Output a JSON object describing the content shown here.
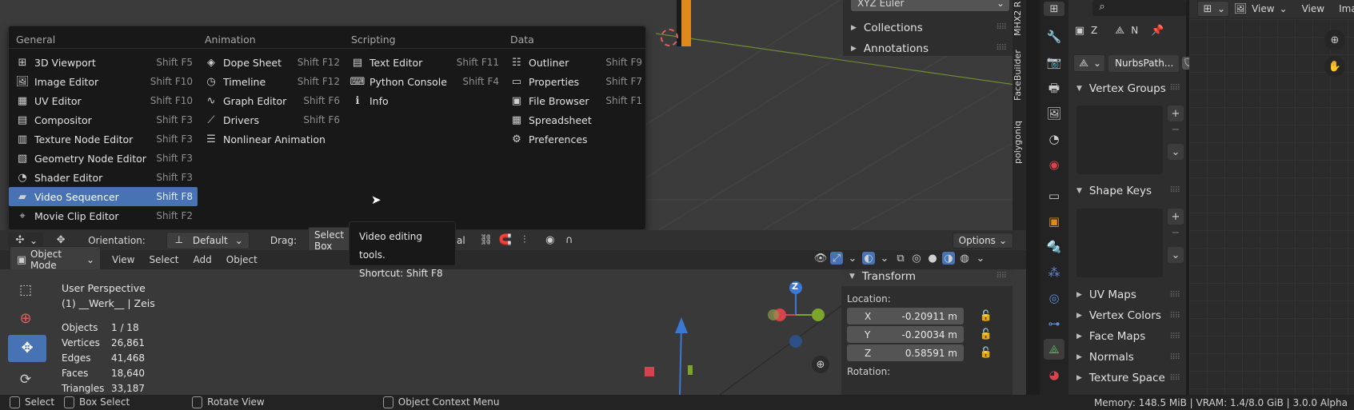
{
  "top_header": {
    "rotation_mode": "XYZ Euler",
    "collapsed_panels": [
      "Collections",
      "Annotations"
    ]
  },
  "side_tabs": [
    "MHX2 R",
    "FaceBuilder",
    "polygoniq"
  ],
  "editor_menu": {
    "columns": [
      {
        "title": "General",
        "items": [
          {
            "label": "3D Viewport",
            "shortcut": "Shift F5",
            "icon": "viewport-3d-icon"
          },
          {
            "label": "Image Editor",
            "shortcut": "Shift F10",
            "icon": "image-editor-icon"
          },
          {
            "label": "UV Editor",
            "shortcut": "Shift F10",
            "icon": "uv-editor-icon"
          },
          {
            "label": "Compositor",
            "shortcut": "Shift F3",
            "icon": "compositor-icon"
          },
          {
            "label": "Texture Node Editor",
            "shortcut": "Shift F3",
            "icon": "texture-node-icon"
          },
          {
            "label": "Geometry Node Editor",
            "shortcut": "Shift F3",
            "icon": "geometry-node-icon"
          },
          {
            "label": "Shader Editor",
            "shortcut": "Shift F3",
            "icon": "shader-editor-icon"
          },
          {
            "label": "Video Sequencer",
            "shortcut": "Shift F8",
            "icon": "video-sequencer-icon",
            "selected": true
          },
          {
            "label": "Movie Clip Editor",
            "shortcut": "Shift F2",
            "icon": "movie-clip-icon"
          }
        ]
      },
      {
        "title": "Animation",
        "items": [
          {
            "label": "Dope Sheet",
            "shortcut": "Shift F12",
            "icon": "dope-sheet-icon"
          },
          {
            "label": "Timeline",
            "shortcut": "Shift F12",
            "icon": "timeline-icon"
          },
          {
            "label": "Graph Editor",
            "shortcut": "Shift F6",
            "icon": "graph-editor-icon"
          },
          {
            "label": "Drivers",
            "shortcut": "Shift F6",
            "icon": "drivers-icon"
          },
          {
            "label": "Nonlinear Animation",
            "shortcut": "",
            "icon": "nla-icon"
          }
        ]
      },
      {
        "title": "Scripting",
        "items": [
          {
            "label": "Text Editor",
            "shortcut": "Shift F11",
            "icon": "text-editor-icon"
          },
          {
            "label": "Python Console",
            "shortcut": "Shift F4",
            "icon": "python-console-icon"
          },
          {
            "label": "Info",
            "shortcut": "",
            "icon": "info-icon"
          }
        ]
      },
      {
        "title": "Data",
        "items": [
          {
            "label": "Outliner",
            "shortcut": "Shift F9",
            "icon": "outliner-icon"
          },
          {
            "label": "Properties",
            "shortcut": "Shift F7",
            "icon": "properties-icon"
          },
          {
            "label": "File Browser",
            "shortcut": "Shift F1",
            "icon": "file-browser-icon"
          },
          {
            "label": "Spreadsheet",
            "shortcut": "",
            "icon": "spreadsheet-icon"
          },
          {
            "label": "Preferences",
            "shortcut": "",
            "icon": "preferences-icon"
          }
        ]
      }
    ]
  },
  "tooltip": {
    "line1": "Video editing tools.",
    "line2": "Shortcut: Shift F8"
  },
  "tool_header": {
    "orientation_label": "Orientation:",
    "orientation_value": "Default",
    "drag_label": "Drag:",
    "drag_value": "Select Box",
    "drag_tail": "al",
    "options": "Options"
  },
  "viewport_header": {
    "mode": "Object Mode",
    "menus": [
      "View",
      "Select",
      "Add",
      "Object"
    ]
  },
  "viewport_overlay": {
    "perspective": "User Perspective",
    "object_info": "(1) __Werk__ | Zeis",
    "stats": [
      {
        "label": "Objects",
        "value": "1 / 18"
      },
      {
        "label": "Vertices",
        "value": "26,861"
      },
      {
        "label": "Edges",
        "value": "41,468"
      },
      {
        "label": "Faces",
        "value": "18,640"
      },
      {
        "label": "Triangles",
        "value": "33,187"
      }
    ],
    "gizmo_z": "Z"
  },
  "transform_panel": {
    "title": "Transform",
    "location_label": "Location:",
    "fields": [
      {
        "axis": "X",
        "value": "-0.20911 m"
      },
      {
        "axis": "Y",
        "value": "-0.20034 m"
      },
      {
        "axis": "Z",
        "value": "0.58591 m"
      }
    ],
    "rotation_label": "Rotation:"
  },
  "properties": {
    "pin_z": "Z",
    "pin_n": "N",
    "data_name": "NurbsPath...",
    "sections": {
      "vertex_groups": "Vertex Groups",
      "shape_keys": "Shape Keys"
    },
    "collapsed": [
      "UV Maps",
      "Vertex Colors",
      "Face Maps",
      "Normals",
      "Texture Space"
    ]
  },
  "image_editor": {
    "view": "View",
    "view2": "View",
    "image": "Imag"
  },
  "status_bar": {
    "select": "Select",
    "box_select": "Box Select",
    "rotate_view": "Rotate View",
    "context_menu": "Object Context Menu",
    "memory": "Memory: 148.5 MiB | VRAM: 1.4/8.0 GiB | 3.0.0 Alpha"
  },
  "colors": {
    "selection": "#4772b3",
    "panel_bg": "#2e2e2e",
    "menu_bg": "#181818",
    "axis_red": "#d8424d",
    "axis_green": "#7ea52b",
    "axis_blue": "#3a78d4"
  }
}
